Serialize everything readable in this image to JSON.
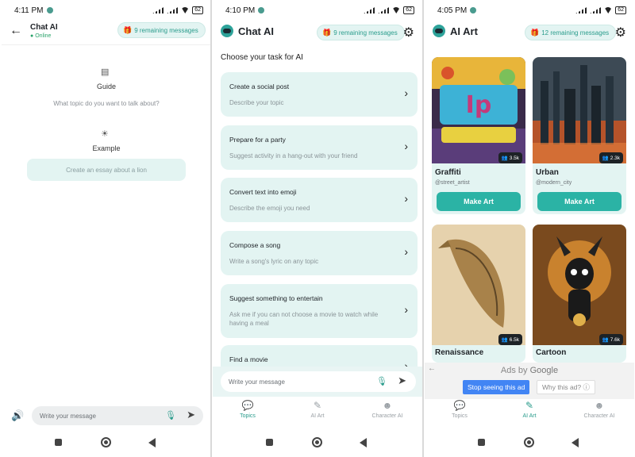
{
  "screen1": {
    "status": {
      "time": "4:11 PM",
      "battery": "62"
    },
    "header": {
      "title": "Chat AI",
      "status": "Online",
      "remaining": "9 remaining messages"
    },
    "guide": {
      "label": "Guide",
      "question": "What topic do you want to talk about?"
    },
    "example": {
      "label": "Example",
      "text": "Create an essay about a lion"
    },
    "input": {
      "placeholder": "Write your message"
    }
  },
  "screen2": {
    "status": {
      "time": "4:10 PM",
      "battery": "62"
    },
    "header": {
      "title": "Chat AI",
      "remaining": "9 remaining messages"
    },
    "heading": "Choose your task for AI",
    "tasks": [
      {
        "title": "Create a social post",
        "subtitle": "Describe your topic"
      },
      {
        "title": "Prepare for a party",
        "subtitle": "Suggest activity in a hang-out with your friend"
      },
      {
        "title": "Convert text into emoji",
        "subtitle": "Describe the emoji you need"
      },
      {
        "title": "Compose a song",
        "subtitle": "Write a song's lyric on any topic"
      },
      {
        "title": "Suggest something to entertain",
        "subtitle": "Ask me if you can not choose a movie to watch while having a meal"
      },
      {
        "title": "Find a movie",
        "subtitle": ""
      }
    ],
    "input": {
      "placeholder": "Write your message"
    },
    "tabs": [
      {
        "label": "Topics",
        "icon": "chat-bubble-icon",
        "active": true
      },
      {
        "label": "AI Art",
        "icon": "pencil-icon",
        "active": false
      },
      {
        "label": "Character AI",
        "icon": "character-icon",
        "active": false
      }
    ]
  },
  "screen3": {
    "status": {
      "time": "4:05 PM",
      "battery": "62"
    },
    "header": {
      "title": "AI Art",
      "remaining": "12 remaining messages"
    },
    "arts": [
      {
        "name": "Graffiti",
        "author": "@street_artist",
        "count": "3.5k",
        "button": "Make Art"
      },
      {
        "name": "Urban",
        "author": "@modern_city",
        "count": "2.3k",
        "button": "Make Art"
      },
      {
        "name": "Renaissance",
        "count": "6.5k"
      },
      {
        "name": "Cartoon",
        "count": "7.6k"
      }
    ],
    "ads": {
      "by": "Ads by",
      "brand": "Google",
      "stop": "Stop seeing this ad",
      "why": "Why this ad? ⓘ"
    },
    "tabs": [
      {
        "label": "Topics",
        "icon": "chat-bubble-icon",
        "active": false
      },
      {
        "label": "AI Art",
        "icon": "magic-wand-icon",
        "active": true
      },
      {
        "label": "Character AI",
        "icon": "character-icon",
        "active": false
      }
    ]
  },
  "colors": {
    "accent": "#2bb3a5",
    "card_bg": "#e3f4f2",
    "ad_blue": "#4285f4"
  }
}
